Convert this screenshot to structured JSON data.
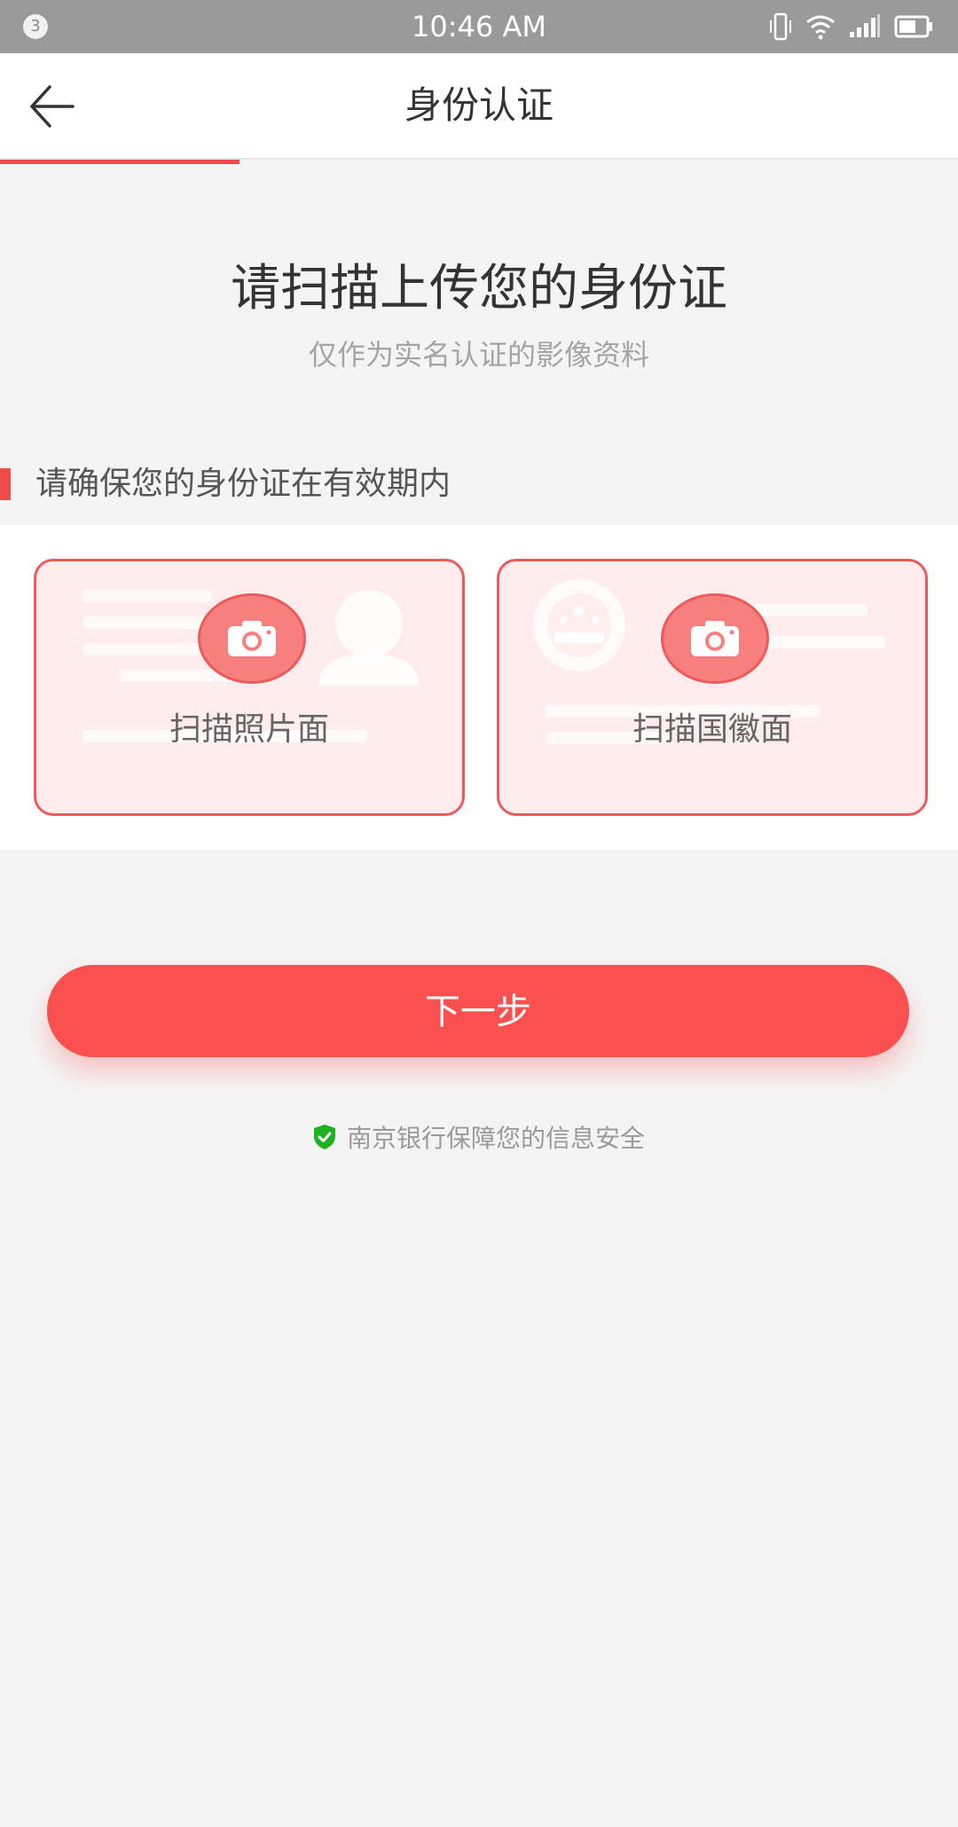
{
  "status_bar": {
    "notification_count": "3",
    "time": "10:46 AM",
    "icons": [
      "vibrate-icon",
      "wifi-icon",
      "signal-icon",
      "battery-icon"
    ]
  },
  "nav": {
    "title": "身份认证",
    "back_icon": "back-arrow-icon"
  },
  "progress": {
    "step_fraction": 0.25,
    "color": "#f04a4a"
  },
  "header": {
    "title": "请扫描上传您的身份证",
    "subtitle": "仅作为实名认证的影像资料"
  },
  "notice": {
    "text": "请确保您的身份证在有效期内"
  },
  "cards": [
    {
      "label": "扫描照片面",
      "icon": "camera-icon"
    },
    {
      "label": "扫描国徽面",
      "icon": "camera-icon"
    }
  ],
  "next_button": {
    "label": "下一步",
    "color": "#fb5050"
  },
  "security_note": {
    "text": "南京银行保障您的信息安全",
    "icon": "shield-check-icon",
    "icon_color": "#1fb21f"
  }
}
